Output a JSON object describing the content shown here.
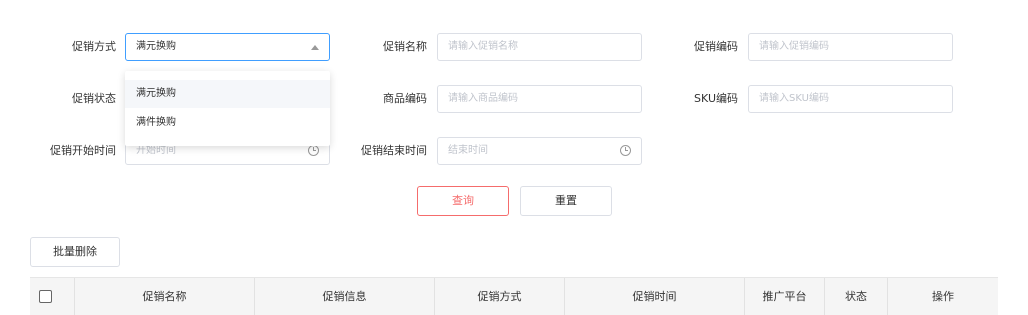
{
  "form": {
    "promo_type": {
      "label": "促销方式",
      "value": "满元换购"
    },
    "promo_name": {
      "label": "促销名称",
      "placeholder": "请输入促销名称"
    },
    "promo_code": {
      "label": "促销编码",
      "placeholder": "请输入促销编码"
    },
    "promo_status": {
      "label": "促销状态"
    },
    "product_code": {
      "label": "商品编码",
      "placeholder": "请输入商品编码"
    },
    "sku_code": {
      "label": "SKU编码",
      "placeholder": "请输入SKU编码"
    },
    "start_time": {
      "label": "促销开始时间",
      "placeholder": "开始时间"
    },
    "end_time": {
      "label": "促销结束时间",
      "placeholder": "结束时间"
    }
  },
  "dropdown": {
    "options": [
      "满元换购",
      "满件换购"
    ],
    "hovered_index": 0
  },
  "buttons": {
    "search": "查询",
    "reset": "重置",
    "batch_delete": "批量删除"
  },
  "table": {
    "columns": [
      "促销名称",
      "促销信息",
      "促销方式",
      "促销时间",
      "推广平台",
      "状态",
      "操作"
    ]
  },
  "colors": {
    "accent_red": "#f56c6c",
    "focus_blue": "#409eff",
    "header_bg": "#f5f5f5"
  }
}
